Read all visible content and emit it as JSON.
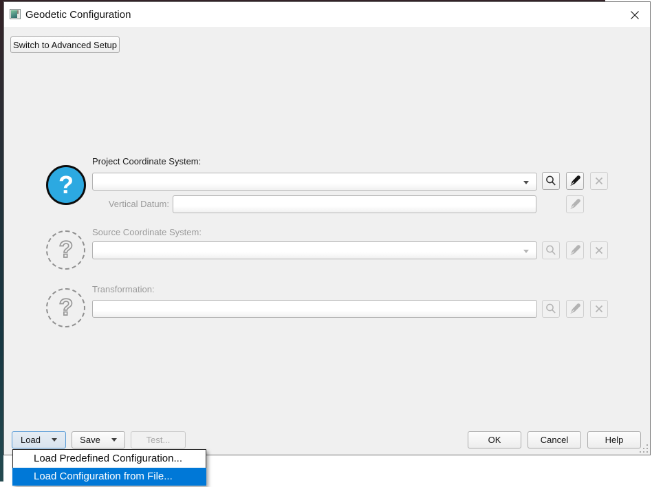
{
  "window": {
    "title": "Geodetic Configuration"
  },
  "toolbar": {
    "switch_button": "Switch to Advanced Setup"
  },
  "form": {
    "project": {
      "label": "Project Coordinate System:",
      "value": "",
      "vertical_datum_label": "Vertical Datum:",
      "vertical_datum_value": ""
    },
    "source": {
      "label": "Source Coordinate System:",
      "value": ""
    },
    "transformation": {
      "label": "Transformation:",
      "value": ""
    }
  },
  "footer": {
    "load_label": "Load",
    "save_label": "Save",
    "test_label": "Test...",
    "ok_label": "OK",
    "cancel_label": "Cancel",
    "help_label": "Help"
  },
  "menu": {
    "items": [
      {
        "label": "Load Predefined Configuration...",
        "highlighted": false
      },
      {
        "label": "Load Configuration from File...",
        "highlighted": true
      }
    ]
  },
  "icons": {
    "question_badge": "?",
    "search": "search-icon",
    "edit_pen": "pen-icon",
    "clear": "x-icon"
  },
  "colors": {
    "menu_highlight": "#0078d7",
    "question_blue": "#2ca9e1",
    "dialog_body": "#f0f0f0",
    "titlebar": "#ffffff",
    "disabled_text": "#9b9b9b",
    "focus_border": "#569ad6"
  }
}
